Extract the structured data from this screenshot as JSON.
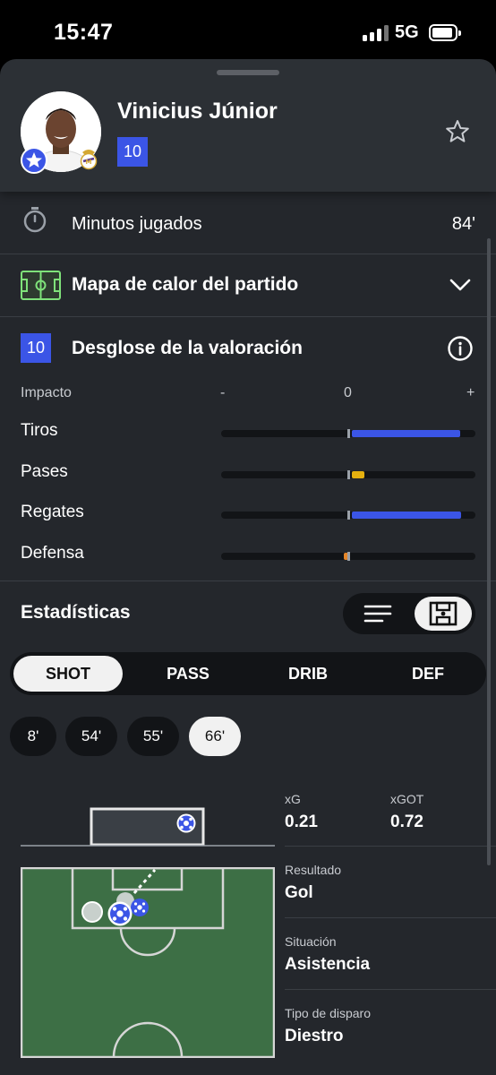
{
  "status_bar": {
    "time": "15:47",
    "network": "5G"
  },
  "player": {
    "name": "Vinicius Júnior",
    "rating": "10"
  },
  "minutes": {
    "label": "Minutos jugados",
    "value": "84'"
  },
  "heatmap": {
    "label": "Mapa de calor del partido"
  },
  "rating_breakdown": {
    "badge": "10",
    "label": "Desglose de la valoración",
    "header": {
      "impact": "Impacto",
      "minus": "-",
      "zero": "0",
      "plus": "+"
    },
    "rows": [
      {
        "label": "Tiros",
        "value": 0.85,
        "color": "#3b55e6"
      },
      {
        "label": "Pases",
        "value": 0.1,
        "color": "#e5b00f"
      },
      {
        "label": "Regates",
        "value": 0.86,
        "color": "#3b55e6"
      },
      {
        "label": "Defensa",
        "value": -0.02,
        "color": "#e5862a"
      }
    ]
  },
  "stats": {
    "title": "Estadísticas",
    "toggle": {
      "list_icon": "list-icon",
      "pitch_icon": "pitch-icon",
      "selected": "pitch"
    }
  },
  "tabs": [
    {
      "label": "SHOT",
      "active": true
    },
    {
      "label": "PASS",
      "active": false
    },
    {
      "label": "DRIB",
      "active": false
    },
    {
      "label": "DEF",
      "active": false
    }
  ],
  "minutes_chips": [
    {
      "label": "8'",
      "active": false
    },
    {
      "label": "54'",
      "active": false
    },
    {
      "label": "55'",
      "active": false
    },
    {
      "label": "66'",
      "active": true
    }
  ],
  "shot_details": {
    "xg_label": "xG",
    "xg_value": "0.21",
    "xgot_label": "xGOT",
    "xgot_value": "0.72",
    "result_label": "Resultado",
    "result_value": "Gol",
    "situation_label": "Situación",
    "situation_value": "Asistencia",
    "shot_type_label": "Tipo de disparo",
    "shot_type_value": "Diestro"
  },
  "colors": {
    "accent": "#3b55e6",
    "background": "#24272c",
    "pitch": "#3d6f45"
  }
}
